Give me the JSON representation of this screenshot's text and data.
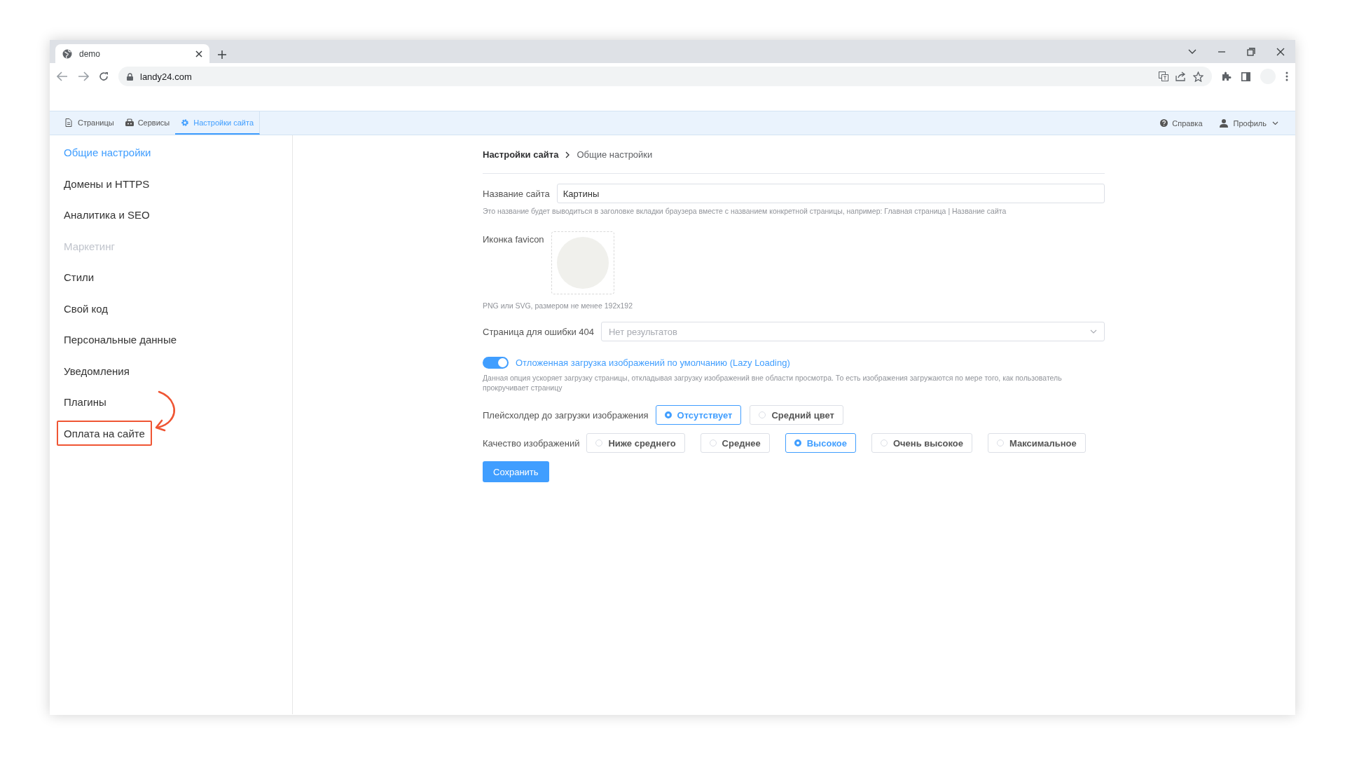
{
  "browser": {
    "tab_title": "demo",
    "url": "landy24.com"
  },
  "app_nav": {
    "tabs": [
      {
        "label": "Страницы",
        "kind": "pages",
        "selected": false
      },
      {
        "label": "Сервисы",
        "kind": "services",
        "selected": false
      },
      {
        "label": "Настройки сайта",
        "kind": "settings",
        "selected": true
      }
    ],
    "help": "Справка",
    "profile": "Профиль"
  },
  "sidebar": {
    "items": [
      {
        "label": "Общие настройки",
        "selected": true,
        "disabled": false,
        "highlighted": false
      },
      {
        "label": "Домены и HTTPS",
        "selected": false,
        "disabled": false,
        "highlighted": false
      },
      {
        "label": "Аналитика и SEO",
        "selected": false,
        "disabled": false,
        "highlighted": false
      },
      {
        "label": "Маркетинг",
        "selected": false,
        "disabled": true,
        "highlighted": false
      },
      {
        "label": "Стили",
        "selected": false,
        "disabled": false,
        "highlighted": false
      },
      {
        "label": "Свой код",
        "selected": false,
        "disabled": false,
        "highlighted": false
      },
      {
        "label": "Персональные данные",
        "selected": false,
        "disabled": false,
        "highlighted": false
      },
      {
        "label": "Уведомления",
        "selected": false,
        "disabled": false,
        "highlighted": false
      },
      {
        "label": "Плагины",
        "selected": false,
        "disabled": false,
        "highlighted": false
      },
      {
        "label": "Оплата на сайте",
        "selected": false,
        "disabled": false,
        "highlighted": true
      }
    ]
  },
  "breadcrumb": [
    "Настройки сайта",
    "Общие настройки"
  ],
  "form": {
    "site_name": {
      "label": "Название сайта",
      "value": "Картины",
      "hint": "Это название будет выводиться в заголовке вкладки браузера вместе с названием конкретной страницы, например: Главная страница | Название сайта"
    },
    "favicon": {
      "label": "Иконка favicon",
      "hint": "PNG или SVG, размером не менее 192x192"
    },
    "error_page": {
      "label": "Страница для ошибки 404",
      "placeholder": "Нет результатов"
    },
    "lazy_loading": {
      "label": "Отложенная загрузка изображений по умолчанию (Lazy Loading)",
      "on": true,
      "description": "Данная опция ускоряет загрузку страницы, откладывая загрузку изображений вне области просмотра. То есть изображения загружаются по мере того, как пользователь прокручивает страницу"
    },
    "image_placeholder": {
      "label": "Плейсхолдер до загрузки изображения",
      "options": [
        {
          "label": "Отсутствует",
          "selected": true
        },
        {
          "label": "Средний цвет",
          "selected": false
        }
      ]
    },
    "image_quality": {
      "label": "Качество изображений",
      "options": [
        {
          "label": "Ниже среднего",
          "selected": false
        },
        {
          "label": "Среднее",
          "selected": false
        },
        {
          "label": "Высокое",
          "selected": true
        },
        {
          "label": "Очень высокое",
          "selected": false
        },
        {
          "label": "Максимальное",
          "selected": false
        }
      ]
    },
    "save_button": "Сохранить"
  }
}
